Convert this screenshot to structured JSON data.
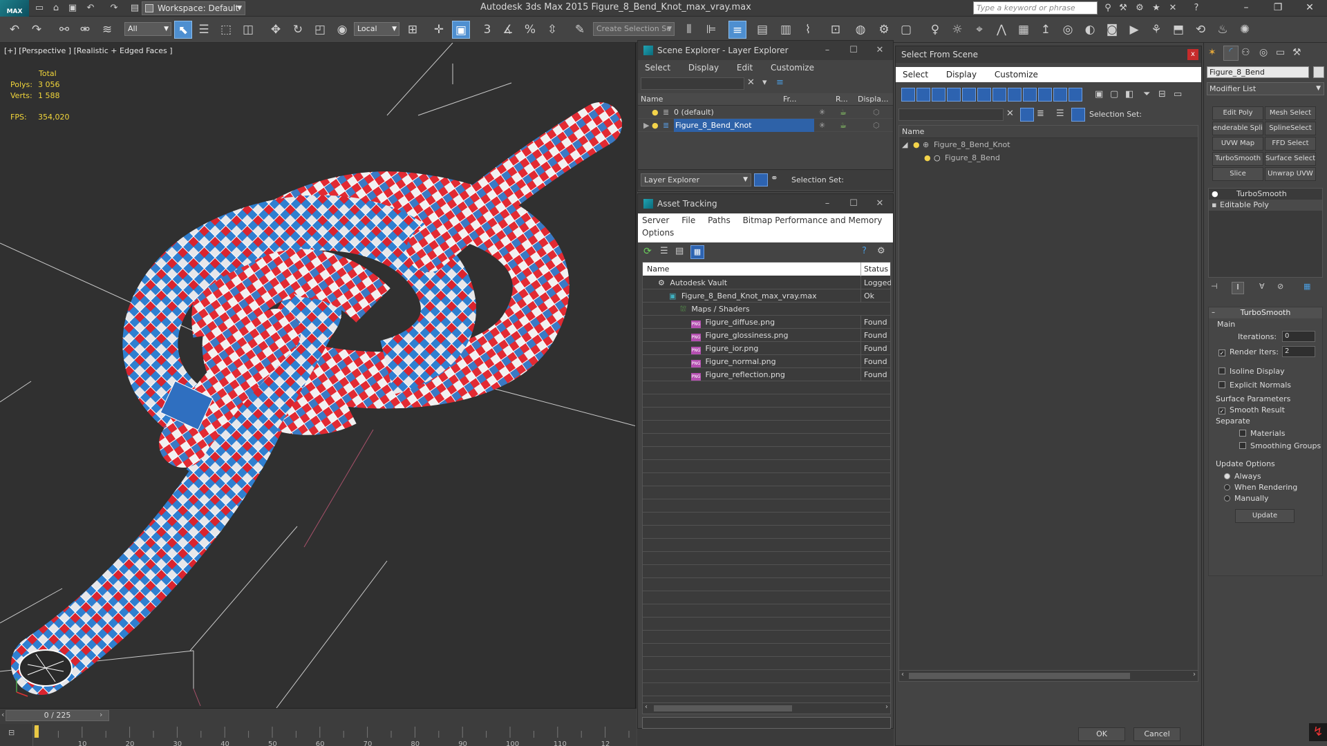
{
  "app": {
    "logo_text": "MAX",
    "title": "Autodesk 3ds Max  2015      Figure_8_Bend_Knot_max_vray.max",
    "workspace": "Workspace: Default",
    "search_placeholder": "Type a keyword or phrase"
  },
  "toolbar": {
    "filter_value": "All",
    "coord_value": "Local",
    "selection_set_placeholder": "Create Selection Se"
  },
  "viewport": {
    "label": "[+] [Perspective ] [Realistic + Edged Faces ]",
    "stats_header": "Total",
    "polys_label": "Polys:",
    "polys_value": "3 056",
    "verts_label": "Verts:",
    "verts_value": "1 588",
    "fps_label": "FPS:",
    "fps_value": "354,020"
  },
  "scene_explorer": {
    "title": "Scene Explorer - Layer Explorer",
    "menu": [
      "Select",
      "Display",
      "Edit",
      "Customize"
    ],
    "columns": [
      "Name",
      "Fr...",
      "R...",
      "Displa..."
    ],
    "rows": [
      {
        "name": "0 (default)",
        "selected": false
      },
      {
        "name": "Figure_8_Bend_Knot",
        "selected": true
      }
    ],
    "footer_dropdown": "Layer Explorer",
    "footer_selection_label": "Selection Set:"
  },
  "asset_tracking": {
    "title": "Asset Tracking",
    "menu": [
      "Server",
      "File",
      "Paths",
      "Bitmap Performance and Memory"
    ],
    "menu2": "Options",
    "columns": [
      "Name",
      "Status"
    ],
    "rows": [
      {
        "name": "Autodesk Vault",
        "status": "Logged Out",
        "indent": 0,
        "icon": "vault"
      },
      {
        "name": "Figure_8_Bend_Knot_max_vray.max",
        "status": "Ok",
        "indent": 1,
        "icon": "max"
      },
      {
        "name": "Maps / Shaders",
        "status": "",
        "indent": 2,
        "icon": "maps"
      },
      {
        "name": "Figure_diffuse.png",
        "status": "Found",
        "indent": 3,
        "icon": "png"
      },
      {
        "name": "Figure_glossiness.png",
        "status": "Found",
        "indent": 3,
        "icon": "png"
      },
      {
        "name": "Figure_ior.png",
        "status": "Found",
        "indent": 3,
        "icon": "png"
      },
      {
        "name": "Figure_normal.png",
        "status": "Found",
        "indent": 3,
        "icon": "png"
      },
      {
        "name": "Figure_reflection.png",
        "status": "Found",
        "indent": 3,
        "icon": "png"
      }
    ]
  },
  "select_from_scene": {
    "title": "Select From Scene",
    "close": "x",
    "menu": [
      "Select",
      "Display",
      "Customize"
    ],
    "selection_set_label": "Selection Set:",
    "column_name": "Name",
    "tree": [
      {
        "name": "Figure_8_Bend_Knot",
        "indent": 0
      },
      {
        "name": "Figure_8_Bend",
        "indent": 1
      }
    ],
    "ok": "OK",
    "cancel": "Cancel"
  },
  "command_panel": {
    "object_name": "Figure_8_Bend",
    "modifier_list": "Modifier List",
    "buttons": [
      "Edit Poly",
      "Mesh Select",
      "enderable Splir",
      "SplineSelect",
      "UVW Map",
      "FFD Select",
      "TurboSmooth",
      "Surface Select",
      "Slice",
      "Unwrap UVW"
    ],
    "stack": [
      "TurboSmooth",
      "Editable Poly"
    ],
    "rollout_title": "TurboSmooth",
    "main_label": "Main",
    "iterations_label": "Iterations:",
    "iterations_value": "0",
    "render_iters_label": "Render Iters:",
    "render_iters_value": "2",
    "isoline_label": "Isoline Display",
    "explicit_normals_label": "Explicit Normals",
    "surface_params_label": "Surface Parameters",
    "smooth_result_label": "Smooth Result",
    "separate_label": "Separate",
    "materials_label": "Materials",
    "smoothing_groups_label": "Smoothing Groups",
    "update_options_label": "Update Options",
    "always_label": "Always",
    "when_rendering_label": "When Rendering",
    "manually_label": "Manually",
    "update_button": "Update"
  },
  "timeline": {
    "slider_label": "0 / 225",
    "ticks": [
      "10",
      "20",
      "30",
      "40",
      "50",
      "60",
      "70",
      "80",
      "90",
      "100",
      "110",
      "12"
    ]
  }
}
